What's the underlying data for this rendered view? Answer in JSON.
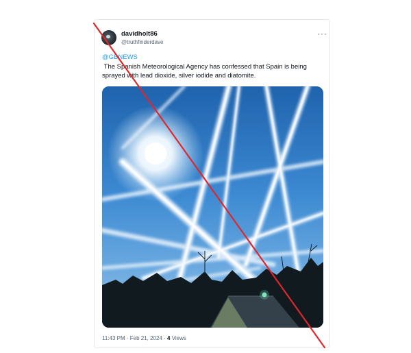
{
  "tweet": {
    "author_name": "davidholt86",
    "author_handle": "@truthfinderdave",
    "more_label": "···",
    "mention": "@GBNEWS",
    "text": " The Spanish Meteorological Agency has confessed that Spain is being\nsprayed with lead dioxide, silver iodide and diatomite.",
    "timestamp": "11:43 PM · Feb 21, 2024 · ",
    "views_count": "4",
    "views_label": " Views"
  },
  "overlay": {
    "strike_color": "#e0262b"
  },
  "icons": {
    "avatar": "avatar-image",
    "more": "more-options-icon"
  }
}
